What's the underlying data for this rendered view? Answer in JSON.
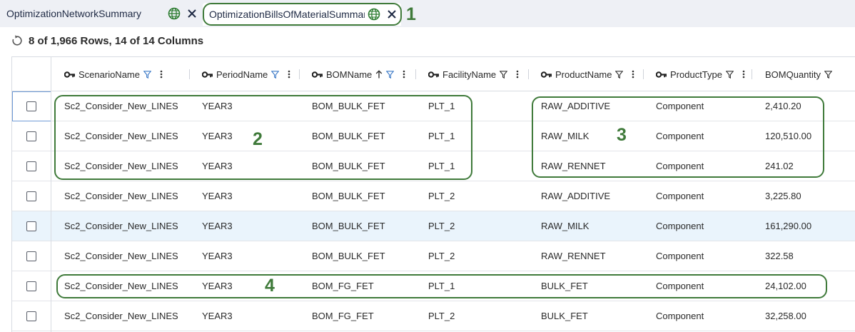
{
  "tabs": [
    {
      "label": "OptimizationNetworkSummary",
      "icon": "globe-icon",
      "close_icon": "close-icon"
    },
    {
      "label": "OptimizationBillsOfMaterialSummary",
      "icon": "globe-icon",
      "close_icon": "close-icon"
    }
  ],
  "status": {
    "text": "8 of 1,966 Rows, 14 of 14 Columns",
    "icon": "refresh-icon"
  },
  "columns": [
    {
      "label": "ScenarioName",
      "key": true,
      "filter": true,
      "sort": ""
    },
    {
      "label": "PeriodName",
      "key": true,
      "filter": true,
      "sort": ""
    },
    {
      "label": "BOMName",
      "key": true,
      "filter": true,
      "sort": "ascending"
    },
    {
      "label": "FacilityName",
      "key": true,
      "filter": true,
      "sort": ""
    },
    {
      "label": "ProductName",
      "key": true,
      "filter": true,
      "sort": ""
    },
    {
      "label": "ProductType",
      "key": true,
      "filter": true,
      "sort": ""
    },
    {
      "label": "BOMQuantity",
      "key": false,
      "filter": true,
      "sort": ""
    }
  ],
  "rows": [
    [
      "Sc2_Consider_New_LINES",
      "YEAR3",
      "BOM_BULK_FET",
      "PLT_1",
      "RAW_ADDITIVE",
      "Component",
      "2,410.20"
    ],
    [
      "Sc2_Consider_New_LINES",
      "YEAR3",
      "BOM_BULK_FET",
      "PLT_1",
      "RAW_MILK",
      "Component",
      "120,510.00"
    ],
    [
      "Sc2_Consider_New_LINES",
      "YEAR3",
      "BOM_BULK_FET",
      "PLT_1",
      "RAW_RENNET",
      "Component",
      "241.02"
    ],
    [
      "Sc2_Consider_New_LINES",
      "YEAR3",
      "BOM_BULK_FET",
      "PLT_2",
      "RAW_ADDITIVE",
      "Component",
      "3,225.80"
    ],
    [
      "Sc2_Consider_New_LINES",
      "YEAR3",
      "BOM_BULK_FET",
      "PLT_2",
      "RAW_MILK",
      "Component",
      "161,290.00"
    ],
    [
      "Sc2_Consider_New_LINES",
      "YEAR3",
      "BOM_BULK_FET",
      "PLT_2",
      "RAW_RENNET",
      "Component",
      "322.58"
    ],
    [
      "Sc2_Consider_New_LINES",
      "YEAR3",
      "BOM_FG_FET",
      "PLT_1",
      "BULK_FET",
      "Component",
      "24,102.00"
    ],
    [
      "Sc2_Consider_New_LINES",
      "YEAR3",
      "BOM_FG_FET",
      "PLT_2",
      "BULK_FET",
      "Component",
      "32,258.00"
    ]
  ],
  "annotations": [
    "1",
    "2",
    "3",
    "4"
  ],
  "colors": {
    "annotation": "#3f7a3a",
    "row_highlight": "#eaf4fc",
    "tab_bar": "#eef0f5",
    "globe": "#2e7d32"
  }
}
